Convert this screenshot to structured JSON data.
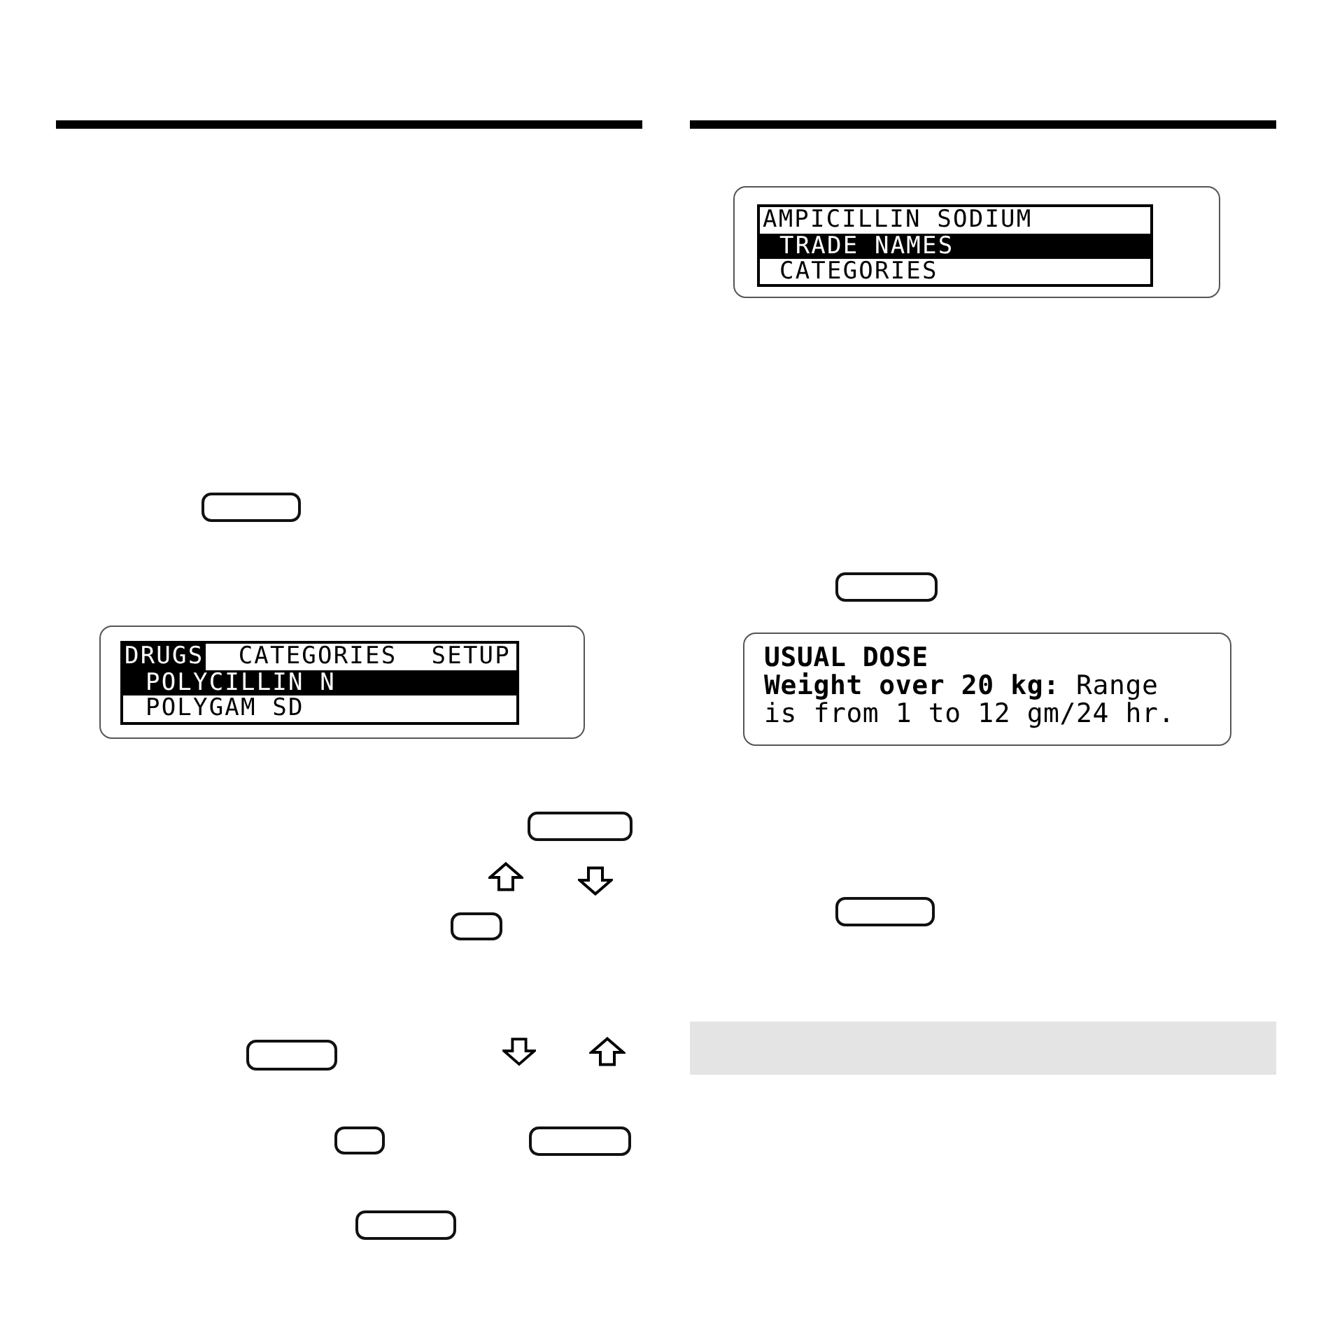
{
  "left_page": {
    "screen": {
      "menu_tabs": [
        {
          "label": "DRUGS",
          "selected": true
        },
        {
          "label": "CATEGORIES",
          "selected": false
        },
        {
          "label": "SETUP",
          "selected": false
        }
      ],
      "entries": [
        {
          "label": "POLYCILLIN N",
          "selected": true
        },
        {
          "label": "POLYGAM SD",
          "selected": false
        }
      ]
    }
  },
  "right_page": {
    "entry_screen": {
      "title": "AMPICILLIN SODIUM",
      "options": [
        {
          "label": "TRADE NAMES",
          "selected": true
        },
        {
          "label": "CATEGORIES",
          "selected": false
        }
      ]
    },
    "dose_screen": {
      "heading": "USUAL DOSE",
      "text": "**Weight over 20 kg:** Range is from 1 to 12 gm/24 hr."
    }
  }
}
